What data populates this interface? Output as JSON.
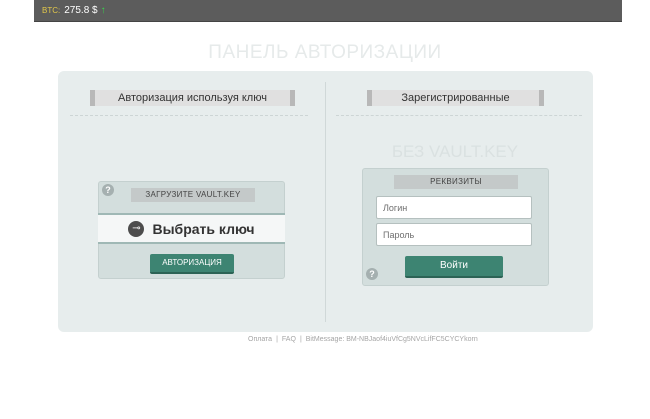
{
  "topbar": {
    "btc_label": "BTC:",
    "btc_value": "275.8 $",
    "btc_trend": "↑"
  },
  "page_title": "ПАНЕЛЬ АВТОРИЗАЦИИ",
  "left": {
    "title": "Авторизация используя ключ",
    "help": "?",
    "upload_label": "ЗАГРУЗИТЕ VAULT.KEY",
    "select_key_label": "Выбрать ключ",
    "key_icon": "key-icon",
    "auth_button": "АВТОРИЗАЦИЯ"
  },
  "right": {
    "title": "Зарегистрированные",
    "watermark": "БЕЗ VAULT.KEY",
    "requisites_label": "РЕКВИЗИТЫ",
    "login_placeholder": "Логин",
    "password_placeholder": "Пароль",
    "help": "?",
    "login_button": "Войти"
  },
  "footer": {
    "payment": "Оплата",
    "sep1": "|",
    "faq": "FAQ",
    "sep2": "|",
    "bitmessage": "BitMessage: BM-NBJaof4iuVfCg5NVcLifFC5CYCYkorn"
  },
  "colors": {
    "accent": "#3d8472",
    "panel": "#e7eded",
    "topbar": "#5c5c5c"
  }
}
